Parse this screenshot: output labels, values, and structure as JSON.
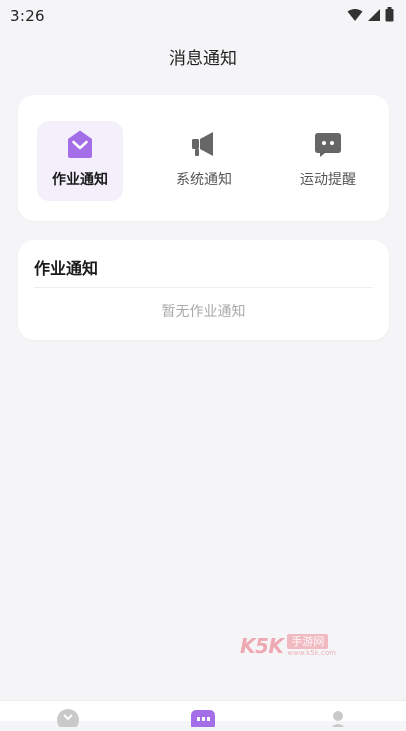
{
  "status_bar": {
    "time": "3:26",
    "icons": [
      "wifi-icon",
      "signal-icon",
      "battery-icon"
    ]
  },
  "header": {
    "title": "消息通知"
  },
  "tabs": [
    {
      "label": "作业通知",
      "icon": "envelope-icon",
      "active": true
    },
    {
      "label": "系统通知",
      "icon": "megaphone-icon",
      "active": false
    },
    {
      "label": "运动提醒",
      "icon": "chat-bubble-icon",
      "active": false
    }
  ],
  "list": {
    "title": "作业通知",
    "empty_text": "暂无作业通知"
  },
  "watermark": {
    "brand": "K5K",
    "site": "手游网",
    "url": "www.k5k.com"
  },
  "bottom_nav": {
    "items": [
      "home-icon",
      "apps-icon",
      "profile-icon"
    ],
    "active_index": 1
  },
  "colors": {
    "accent": "#a46ee8",
    "icon_gray": "#666666",
    "background": "#f5f5f7",
    "card": "#ffffff",
    "active_tab_bg": "#f3effb"
  }
}
